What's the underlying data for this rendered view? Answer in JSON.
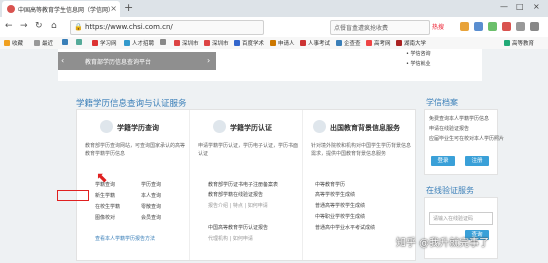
{
  "browser": {
    "tab_title": "中国高等教育学生信息网（学信网）| 首页",
    "tab_close": "×",
    "new_tab": "+",
    "window_buttons": [
      "—",
      "□",
      "×"
    ],
    "nav_back": "←",
    "nav_forward": "→",
    "nav_refresh": "↻",
    "nav_home": "⌂",
    "url": "https://www.chsi.com.cn/",
    "search_placeholder": "点餐盲盒遭疯抢收费",
    "search_hot": "热搜"
  },
  "bookmarks": [
    {
      "label": "收藏",
      "color": "#f0a020"
    },
    {
      "label": "最近",
      "color": "#999"
    },
    {
      "label": "",
      "color": "#3a7fb8"
    },
    {
      "label": "",
      "color": "#5a9"
    },
    {
      "label": "学习网",
      "color": "#d33"
    },
    {
      "label": "人才招聘",
      "color": "#39c"
    },
    {
      "label": "",
      "color": "#888"
    },
    {
      "label": "深圳市",
      "color": "#d44"
    },
    {
      "label": "深圳市",
      "color": "#d44"
    },
    {
      "label": "百度学术",
      "color": "#36c"
    },
    {
      "label": "申请人",
      "color": "#c70"
    },
    {
      "label": "人事考试",
      "color": "#c33"
    },
    {
      "label": "企查查",
      "color": "#3a7fb8"
    },
    {
      "label": "高考网",
      "color": "#e44"
    },
    {
      "label": "湖南大学",
      "color": "#a22"
    },
    {
      "label": "高等教育",
      "color": "#2a7"
    }
  ],
  "top": {
    "banner_text": "教育部学历信息查询平台",
    "banner_prev": "‹",
    "banner_next": "›",
    "right_links": [
      "• 学信咨询",
      "• 学信就业"
    ]
  },
  "main": {
    "section_title": "学籍学历信息查询与认证服务",
    "col1": {
      "title": "学籍学历查询",
      "desc": "教育部学历查询网站，可查询国家承认的高等教育学籍学历信息",
      "links": [
        "学籍查询",
        "学历查询",
        "新生学籍",
        "本人查询",
        "在校生学籍",
        "零散查询",
        "图像校对",
        "会员查询"
      ],
      "bottom_link": "查看本人学籍学历报告方法"
    },
    "col2": {
      "title": "学籍学历认证",
      "desc": "申请学籍学历认证，学历电子认证，学历书面认证",
      "sub1": "教育部学历证书电子注册备案表",
      "sub2": "教育部学籍在线验证报告",
      "meta1": "报告介绍 | 特点 | 如何申请",
      "sub3": "中国高等教育学历认证报告",
      "meta2": "代理机构 | 如何申请"
    },
    "col3": {
      "title": "出国教育背景信息服务",
      "desc": "针对境外院校和机构对中国学生学历背景信息需求，提供中国教育背景信息服务",
      "items": [
        "中等教育学历",
        "高等学校学生成绩",
        "普通高等学校学生成绩",
        "中等职业学校学生成绩",
        "普通高中学业水平考试成绩"
      ]
    }
  },
  "sidebar": {
    "archive_title": "学信档案",
    "archive_lines": [
      "免费查询本人学籍学历信息",
      "申请在线验证报告",
      "应届毕业生可在校对本人学历照片"
    ],
    "login_label": "登录",
    "register_label": "注册",
    "verify_title": "在线验证服务",
    "verify_placeholder": "请输入在线验证码",
    "verify_button": "查询"
  },
  "watermark": "知乎 @我升就完事了"
}
